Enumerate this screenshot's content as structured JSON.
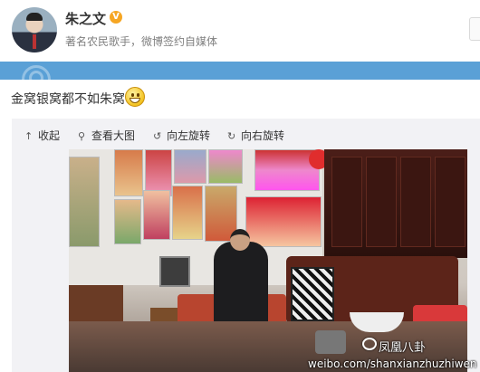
{
  "header": {
    "username": "朱之文",
    "verified_badge": "V",
    "bio": "著名农民歌手，微博签约自媒体"
  },
  "post": {
    "text": "金窝银窝都不如朱窝",
    "emoji": "grin-emoji"
  },
  "toolbar": {
    "items": [
      {
        "label": "收起",
        "icon": "arrow-up-icon",
        "glyph": "↑"
      },
      {
        "label": "查看大图",
        "icon": "magnifier-icon",
        "glyph": "⚲"
      },
      {
        "label": "向左旋转",
        "icon": "rotate-left-icon",
        "glyph": "↺"
      },
      {
        "label": "向右旋转",
        "icon": "rotate-right-icon",
        "glyph": "↻"
      }
    ]
  },
  "photo": {
    "watermark_brand": "凤凰八卦",
    "watermark_url": "weibo.com/shanxianzhuzhiwen"
  },
  "colors": {
    "banner": "#5aa0d6",
    "verified": "#f6a623"
  }
}
